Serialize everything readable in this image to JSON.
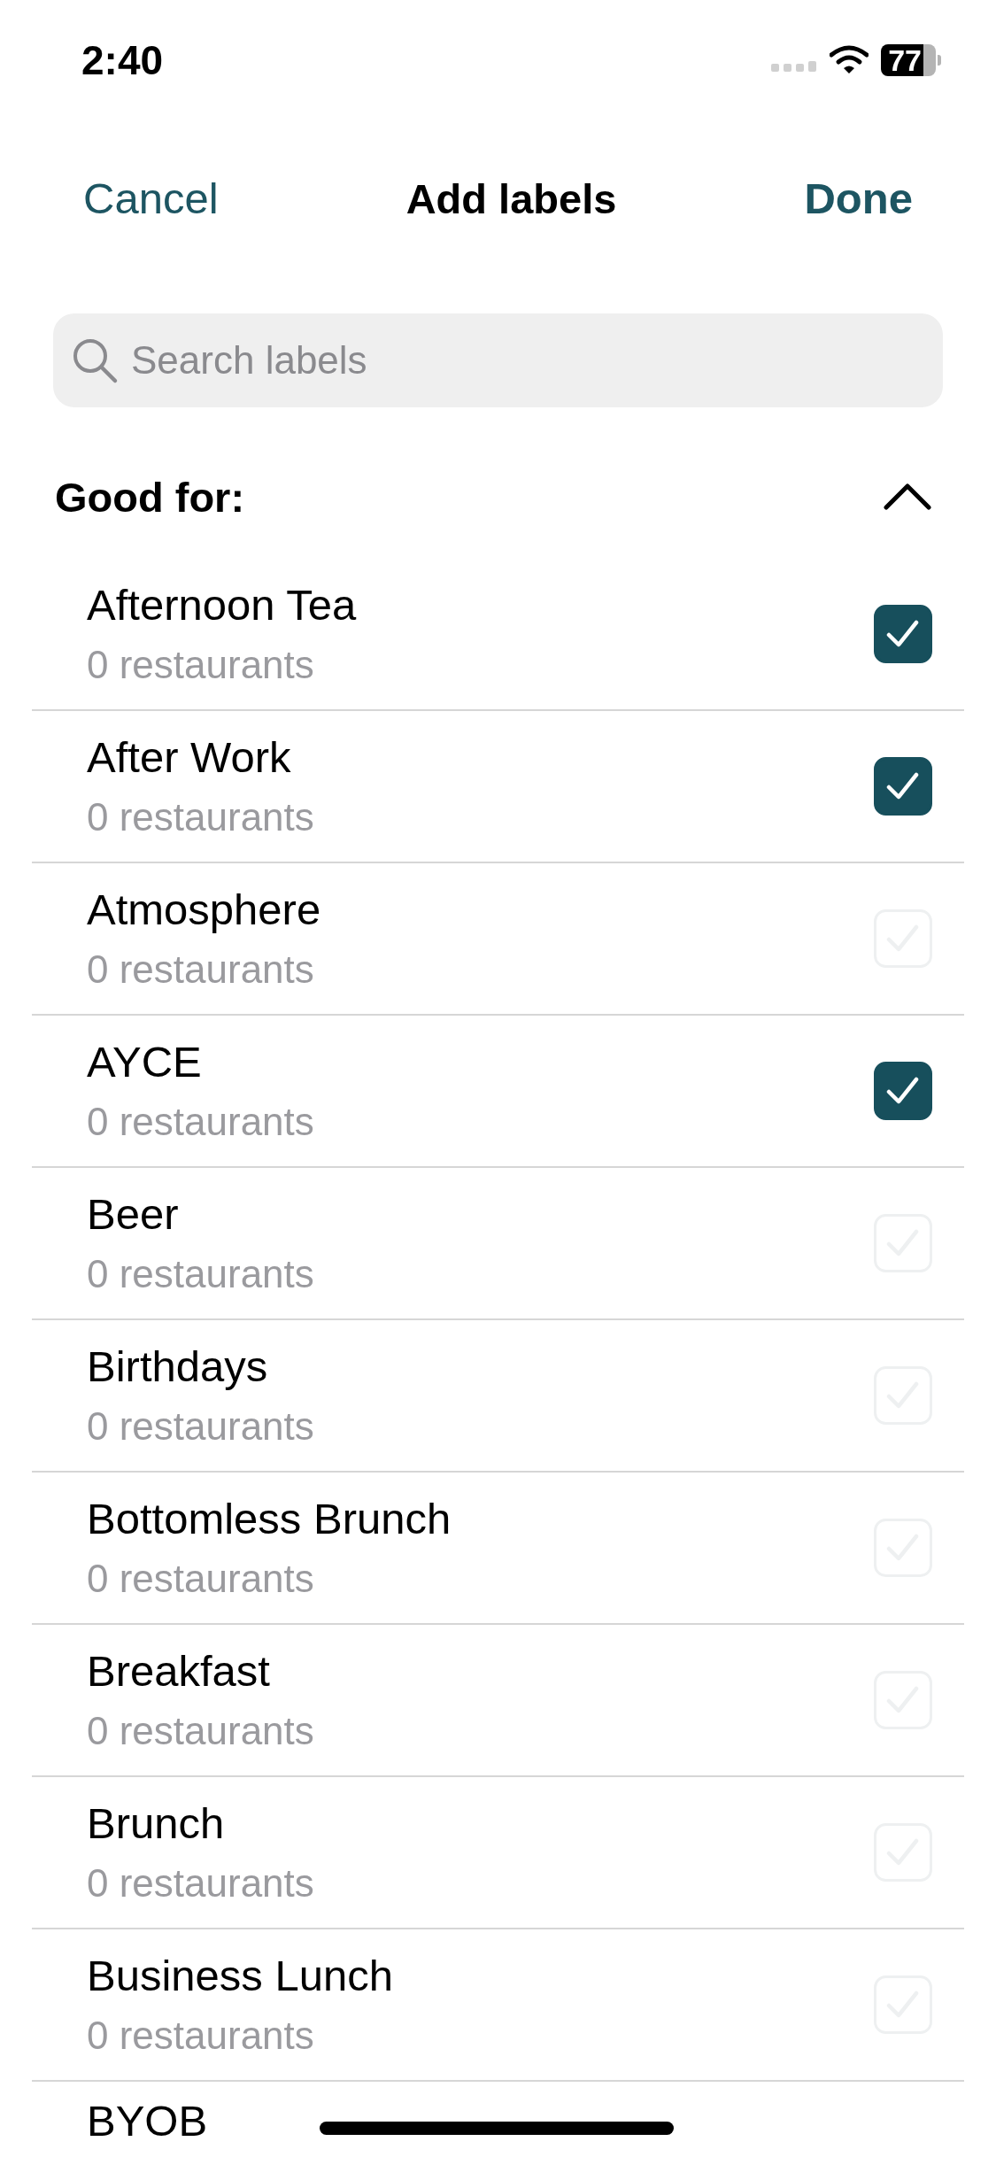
{
  "status_bar": {
    "time": "2:40",
    "battery": "77"
  },
  "nav": {
    "cancel": "Cancel",
    "title": "Add labels",
    "done": "Done"
  },
  "search": {
    "placeholder": "Search labels"
  },
  "section": {
    "title": "Good for:",
    "expanded": true
  },
  "labels": [
    {
      "name": "Afternoon Tea",
      "count": "0 restaurants",
      "checked": true
    },
    {
      "name": "After Work",
      "count": "0 restaurants",
      "checked": true
    },
    {
      "name": "Atmosphere",
      "count": "0 restaurants",
      "checked": false
    },
    {
      "name": "AYCE",
      "count": "0 restaurants",
      "checked": true
    },
    {
      "name": "Beer",
      "count": "0 restaurants",
      "checked": false
    },
    {
      "name": "Birthdays",
      "count": "0 restaurants",
      "checked": false
    },
    {
      "name": "Bottomless Brunch",
      "count": "0 restaurants",
      "checked": false
    },
    {
      "name": "Breakfast",
      "count": "0 restaurants",
      "checked": false
    },
    {
      "name": "Brunch",
      "count": "0 restaurants",
      "checked": false
    },
    {
      "name": "Business Lunch",
      "count": "0 restaurants",
      "checked": false
    },
    {
      "name": "BYOB"
    }
  ]
}
